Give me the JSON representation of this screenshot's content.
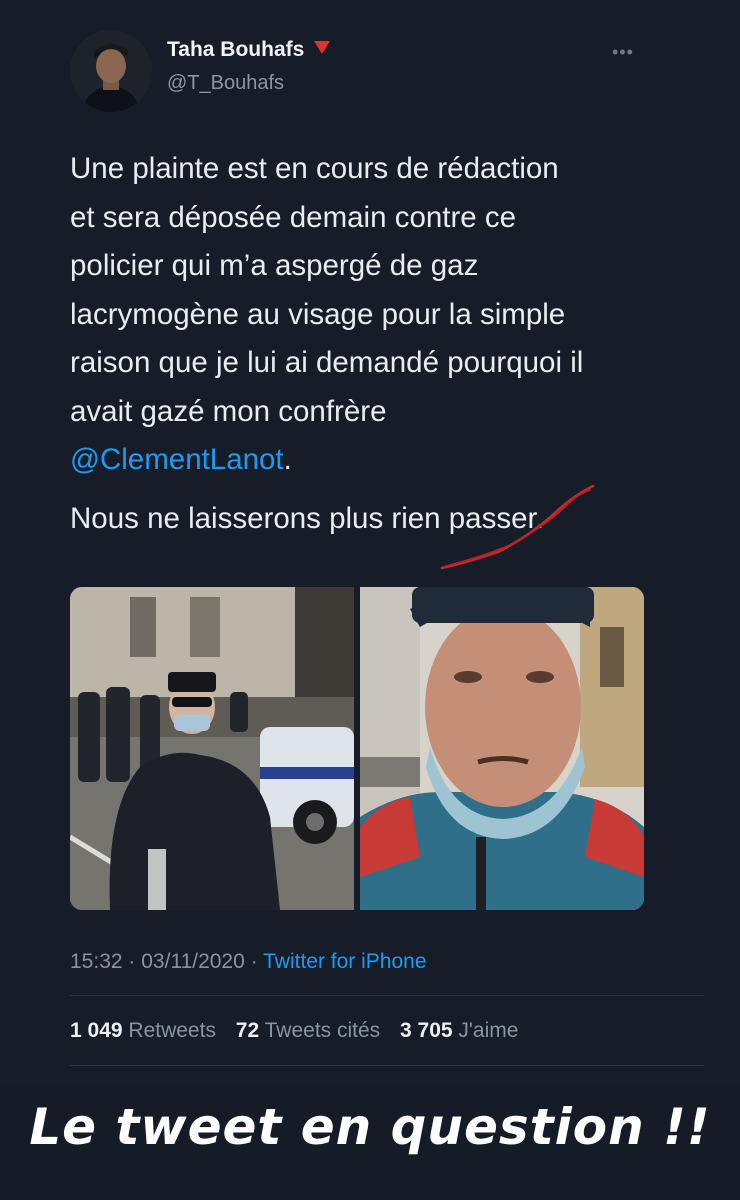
{
  "tweet": {
    "author_name": "Taha Bouhafs",
    "handle": "@T_Bouhafs",
    "more_label": "•••",
    "text_lines": [
      "Une plainte est en cours de rédaction",
      "et sera déposée demain contre ce",
      "policier qui m’a aspergé de gaz",
      "lacrymogène au visage pour la simple",
      "raison que je lui ai demandé pourquoi il",
      "avait gazé mon confrère"
    ],
    "mention": "@ClementLanot",
    "mention_suffix": ".",
    "text_line_2": "Nous ne laisserons plus rien passer.",
    "time": "15:32",
    "date": "03/11/2020",
    "separator": "·",
    "source": "Twitter for iPhone",
    "stats": {
      "retweets_count": "1 049",
      "retweets_label": "Retweets",
      "quotes_count": "72",
      "quotes_label": "Tweets cités",
      "likes_count": "3 705",
      "likes_label": "J'aime"
    },
    "colors": {
      "link": "#1d9bf0",
      "flag": "#e0312a",
      "background": "#161d29"
    }
  },
  "caption": "Le tweet en question !!"
}
